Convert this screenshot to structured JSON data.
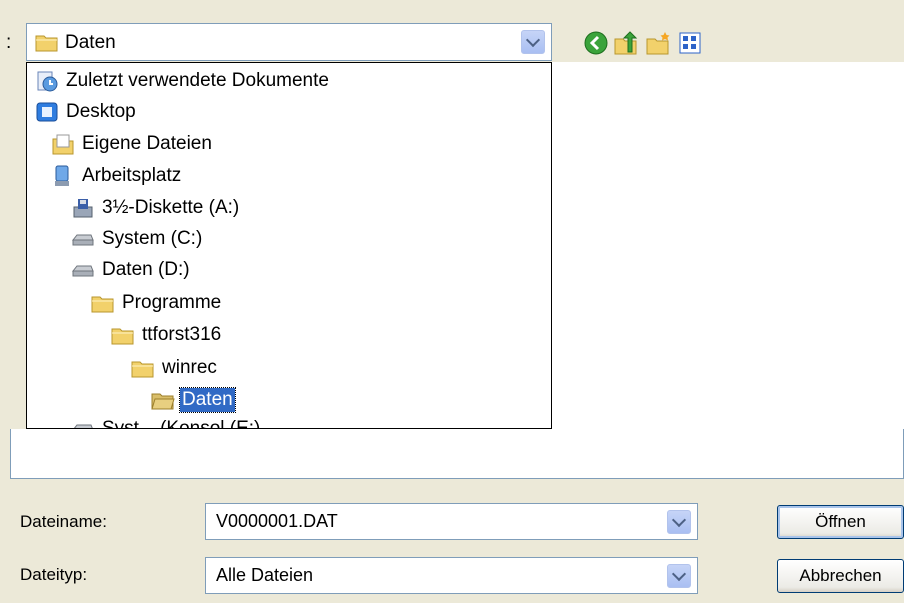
{
  "lookin": {
    "colon": ":",
    "selected": "Daten"
  },
  "toolbar": {
    "icons": [
      "back-icon",
      "up-folder-icon",
      "new-folder-icon",
      "view-menu-icon"
    ]
  },
  "locations": [
    {
      "label": "Zuletzt verwendete Dokumente",
      "icon": "recent-documents-icon",
      "level": 0
    },
    {
      "label": "Desktop",
      "icon": "desktop-icon",
      "level": 0
    },
    {
      "label": "Eigene Dateien",
      "icon": "my-documents-icon",
      "level": 1
    },
    {
      "label": "Arbeitsplatz",
      "icon": "my-computer-icon",
      "level": 1
    },
    {
      "label": "3½-Diskette (A:)",
      "icon": "floppy-drive-icon",
      "level": 2
    },
    {
      "label": "System (C:)",
      "icon": "hard-drive-icon",
      "level": 2
    },
    {
      "label": "Daten (D:)",
      "icon": "hard-drive-icon",
      "level": 2
    },
    {
      "label": "Programme",
      "icon": "folder-icon",
      "level": 3
    },
    {
      "label": "ttforst316",
      "icon": "folder-icon",
      "level": 4
    },
    {
      "label": "winrec",
      "icon": "folder-icon",
      "level": 5
    },
    {
      "label": "Daten",
      "icon": "open-folder-icon",
      "level": 6,
      "selected": true
    },
    {
      "label": "Syst... (Konsol (E:)",
      "icon": "hard-drive-icon",
      "level": 2,
      "partial": true
    }
  ],
  "filename": {
    "label": "Dateiname:",
    "value": "V0000001.DAT"
  },
  "filetype": {
    "label": "Dateityp:",
    "value": "Alle Dateien"
  },
  "buttons": {
    "open": "Öffnen",
    "cancel": "Abbrechen"
  },
  "colors": {
    "dialog_bg": "#ECE9D8",
    "selection": "#316AC5",
    "folder": "#F2D16B",
    "combo_border": "#7F9DB9"
  }
}
